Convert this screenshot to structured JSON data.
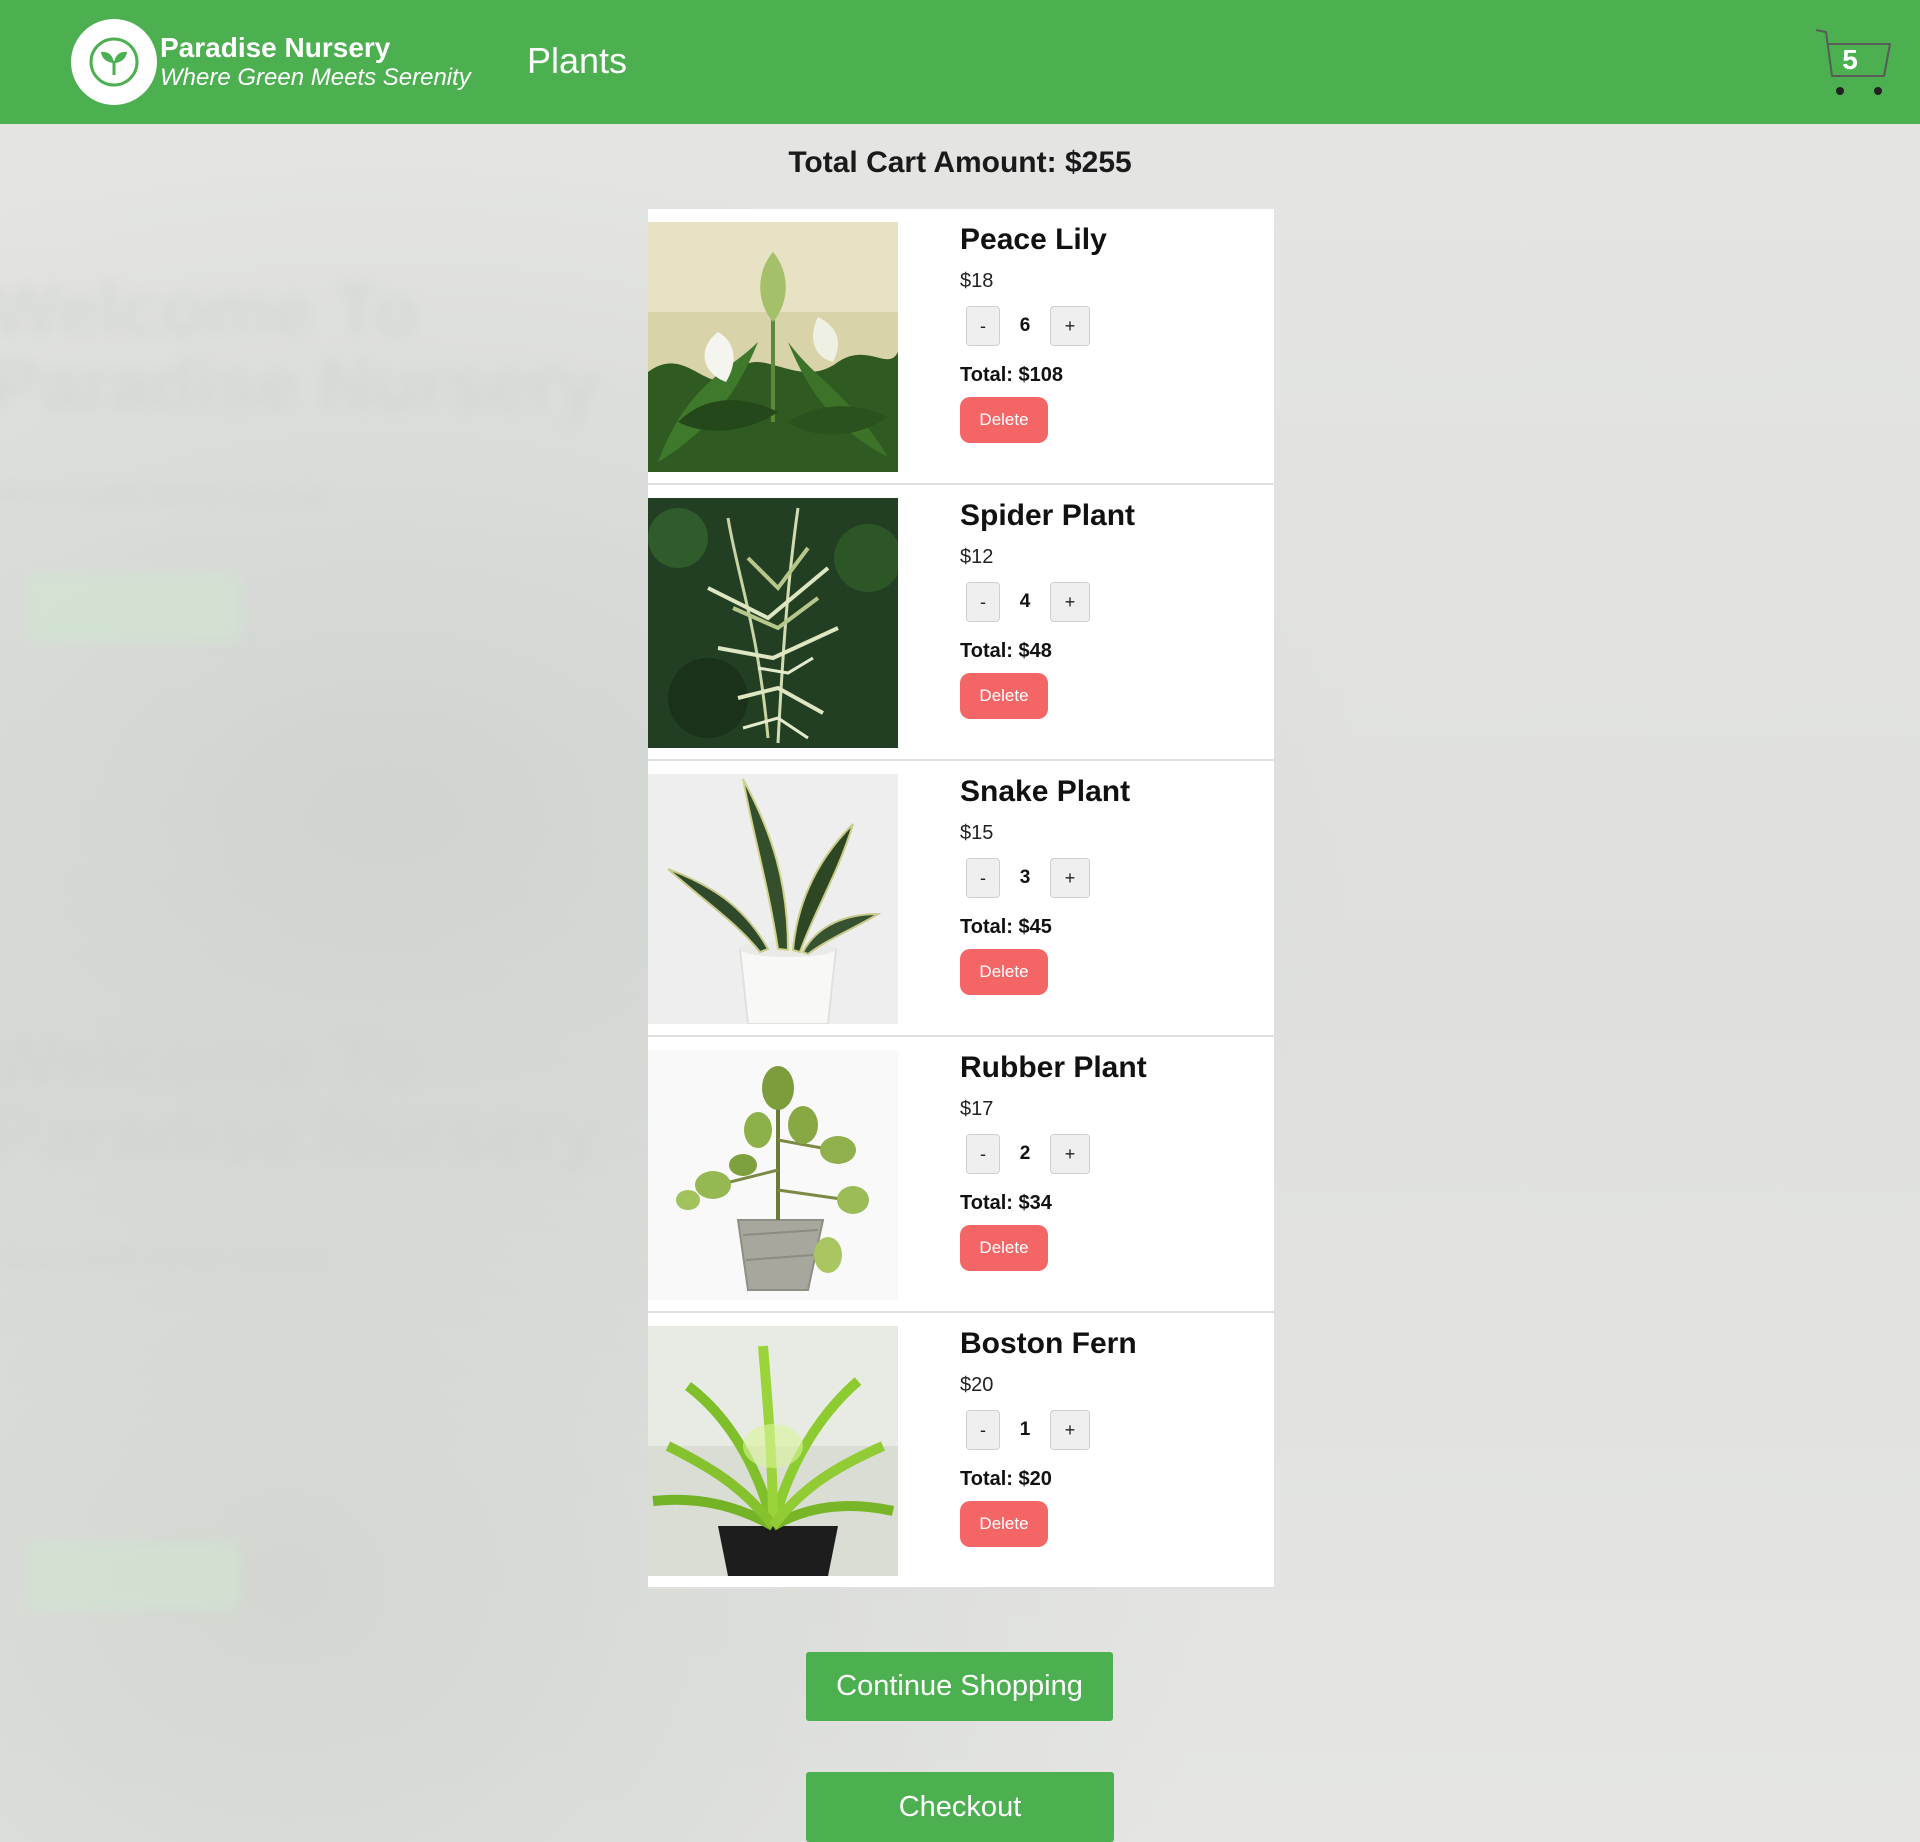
{
  "header": {
    "brand_name": "Paradise Nursery",
    "brand_tagline": "Where Green Meets Serenity",
    "nav_plants": "Plants",
    "cart_count": "5",
    "background_color": "#4caf50"
  },
  "background": {
    "heading_line1": "Welcome To",
    "heading_line2": "Paradise Nursery"
  },
  "cart": {
    "total_label": "Total Cart Amount: $255",
    "items": [
      {
        "name": "Peace Lily",
        "price": "$18",
        "quantity": "6",
        "total": "Total: $108",
        "delete_label": "Delete",
        "minus_label": "-",
        "plus_label": "+"
      },
      {
        "name": "Spider Plant",
        "price": "$12",
        "quantity": "4",
        "total": "Total: $48",
        "delete_label": "Delete",
        "minus_label": "-",
        "plus_label": "+"
      },
      {
        "name": "Snake Plant",
        "price": "$15",
        "quantity": "3",
        "total": "Total: $45",
        "delete_label": "Delete",
        "minus_label": "-",
        "plus_label": "+"
      },
      {
        "name": "Rubber Plant",
        "price": "$17",
        "quantity": "2",
        "total": "Total: $34",
        "delete_label": "Delete",
        "minus_label": "-",
        "plus_label": "+"
      },
      {
        "name": "Boston Fern",
        "price": "$20",
        "quantity": "1",
        "total": "Total: $20",
        "delete_label": "Delete",
        "minus_label": "-",
        "plus_label": "+"
      }
    ],
    "continue_label": "Continue Shopping",
    "checkout_label": "Checkout",
    "delete_color": "#f46666",
    "accent_color": "#4caf50"
  }
}
